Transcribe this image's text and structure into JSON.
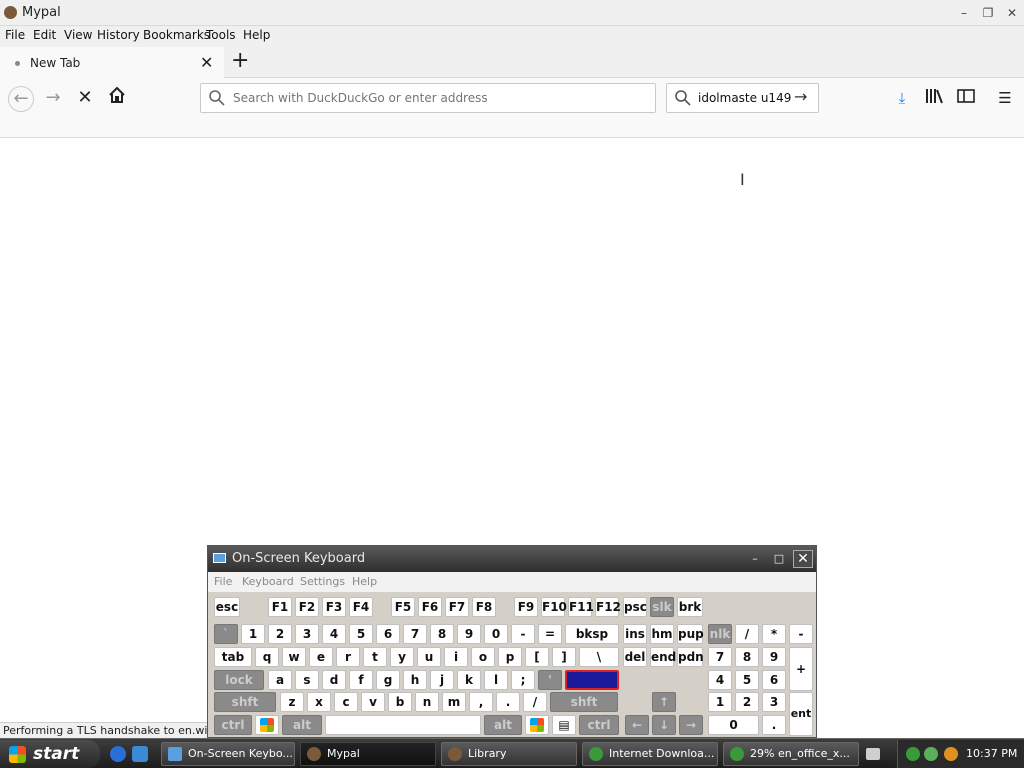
{
  "window": {
    "title": "Mypal"
  },
  "menu": [
    "File",
    "Edit",
    "View",
    "History",
    "Bookmarks",
    "Tools",
    "Help"
  ],
  "tab": {
    "label": "New Tab"
  },
  "urlbar": {
    "placeholder": "Search with DuckDuckGo or enter address",
    "value": ""
  },
  "searchbar": {
    "value": "idolmaste u149"
  },
  "status": {
    "text": "Performing a TLS handshake to en.wikipedia.org..."
  },
  "osk": {
    "title": "On-Screen Keyboard",
    "menu": [
      "File",
      "Keyboard",
      "Settings",
      "Help"
    ],
    "row0": [
      "esc",
      "F1",
      "F2",
      "F3",
      "F4",
      "F5",
      "F6",
      "F7",
      "F8",
      "F9",
      "F10",
      "F11",
      "F12",
      "psc",
      "slk",
      "brk"
    ],
    "row1": [
      "`",
      "1",
      "2",
      "3",
      "4",
      "5",
      "6",
      "7",
      "8",
      "9",
      "0",
      "-",
      "=",
      "bksp",
      "ins",
      "hm",
      "pup",
      "nlk",
      "/",
      "*",
      "-"
    ],
    "row2": [
      "tab",
      "q",
      "w",
      "e",
      "r",
      "t",
      "y",
      "u",
      "i",
      "o",
      "p",
      "[",
      "]",
      "\\",
      "del",
      "end",
      "pdn",
      "7",
      "8",
      "9",
      "+"
    ],
    "row3": [
      "lock",
      "a",
      "s",
      "d",
      "f",
      "g",
      "h",
      "j",
      "k",
      "l",
      ";",
      "'",
      "",
      "4",
      "5",
      "6"
    ],
    "row4": [
      "shft",
      "z",
      "x",
      "c",
      "v",
      "b",
      "n",
      "m",
      ",",
      ".",
      "/",
      "shft",
      "↑",
      "1",
      "2",
      "3",
      "ent"
    ],
    "row5": [
      "ctrl",
      "alt",
      "",
      "alt",
      "ctrl",
      "←",
      "↓",
      "→",
      "0",
      "."
    ]
  },
  "taskbar": {
    "start": "start",
    "tasks": [
      "On-Screen Keybo...",
      "Mypal",
      "Library",
      "Internet Downloa...",
      "29% en_office_x..."
    ],
    "clock": "10:37 PM"
  },
  "colors": {
    "accent": "#0a84ff",
    "selected_key": "#1a1a9a"
  }
}
